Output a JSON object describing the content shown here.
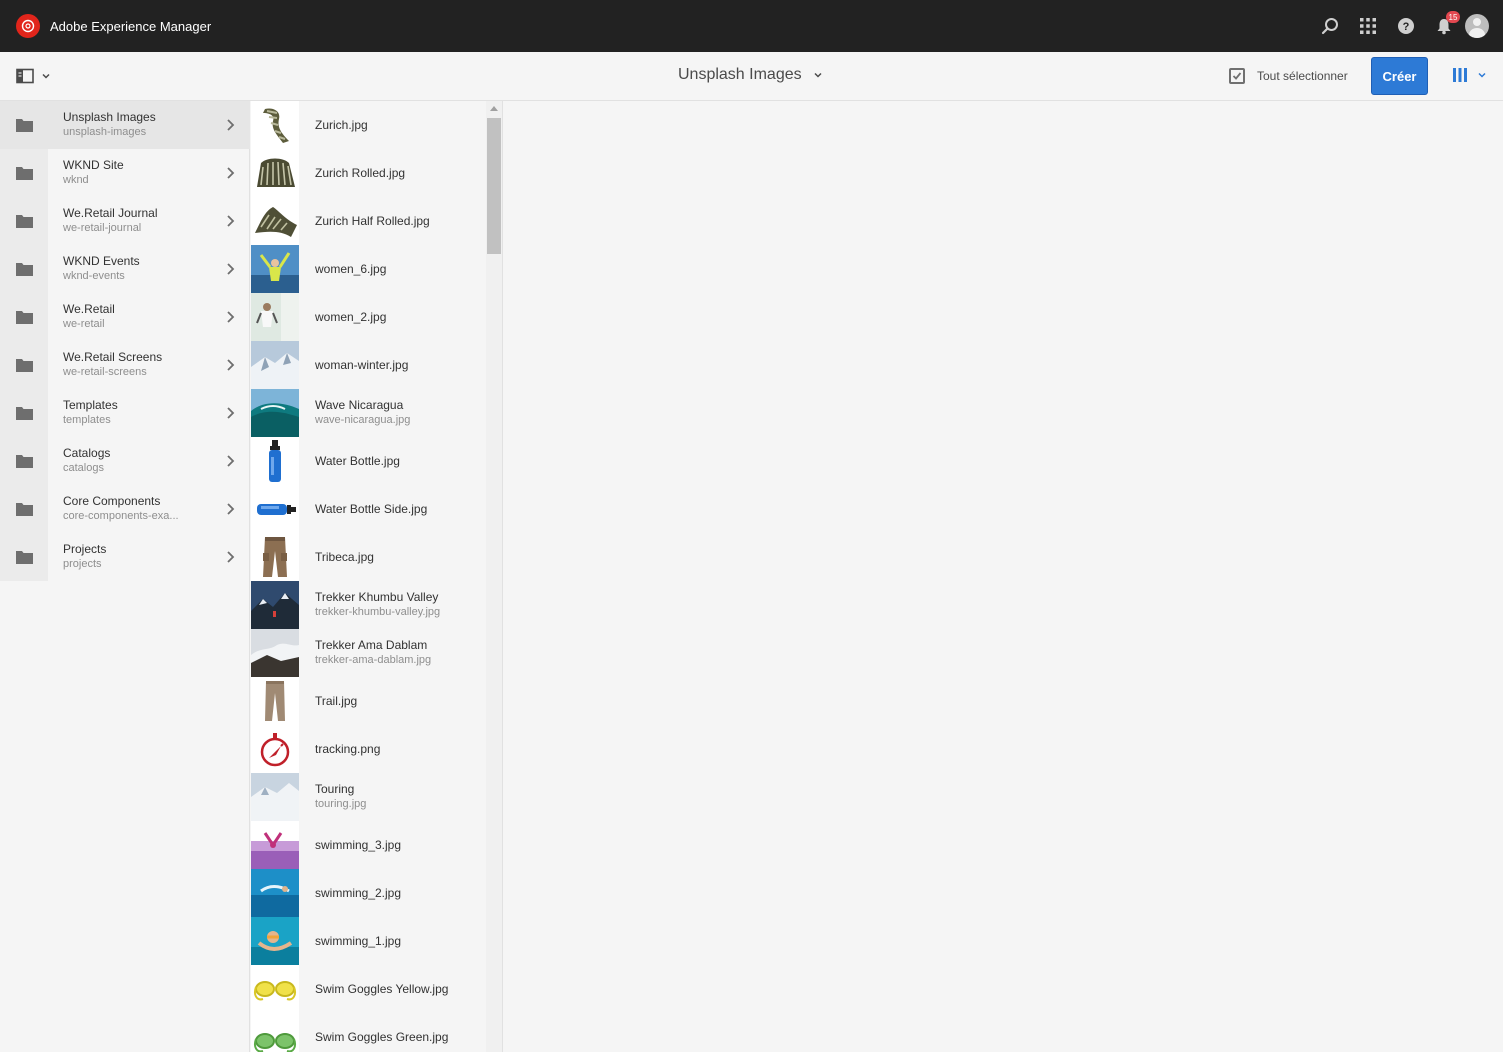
{
  "shell": {
    "app_title": "Adobe Experience Manager",
    "icons": [
      "adobe-logo-icon",
      "search-icon",
      "apps-grid-icon",
      "help-icon",
      "bell-icon",
      "avatar"
    ],
    "notification_count": "15"
  },
  "actionbar": {
    "title": "Unsplash Images",
    "select_all": "Tout sélectionner",
    "create": "Créer",
    "view": "column-view-icon"
  },
  "column1": [
    {
      "title": "Unsplash Images",
      "name": "unsplash-images",
      "selected": true
    },
    {
      "title": "WKND Site",
      "name": "wknd"
    },
    {
      "title": "We.Retail Journal",
      "name": "we-retail-journal"
    },
    {
      "title": "WKND Events",
      "name": "wknd-events"
    },
    {
      "title": "We.Retail",
      "name": "we-retail"
    },
    {
      "title": "We.Retail Screens",
      "name": "we-retail-screens"
    },
    {
      "title": "Templates",
      "name": "templates"
    },
    {
      "title": "Catalogs",
      "name": "catalogs"
    },
    {
      "title": "Core Components",
      "name": "core-components-exa..."
    },
    {
      "title": "Projects",
      "name": "projects"
    }
  ],
  "column2": [
    {
      "title": "Zurich.jpg",
      "name": ""
    },
    {
      "title": "Zurich Rolled.jpg",
      "name": ""
    },
    {
      "title": "Zurich Half Rolled.jpg",
      "name": ""
    },
    {
      "title": "women_6.jpg",
      "name": ""
    },
    {
      "title": "women_2.jpg",
      "name": ""
    },
    {
      "title": "woman-winter.jpg",
      "name": ""
    },
    {
      "title": "Wave Nicaragua",
      "name": "wave-nicaragua.jpg"
    },
    {
      "title": "Water Bottle.jpg",
      "name": ""
    },
    {
      "title": "Water Bottle Side.jpg",
      "name": ""
    },
    {
      "title": "Tribeca.jpg",
      "name": ""
    },
    {
      "title": "Trekker Khumbu Valley",
      "name": "trekker-khumbu-valley.jpg"
    },
    {
      "title": "Trekker Ama Dablam",
      "name": "trekker-ama-dablam.jpg"
    },
    {
      "title": "Trail.jpg",
      "name": ""
    },
    {
      "title": "tracking.png",
      "name": ""
    },
    {
      "title": "Touring",
      "name": "touring.jpg"
    },
    {
      "title": "swimming_3.jpg",
      "name": ""
    },
    {
      "title": "swimming_2.jpg",
      "name": ""
    },
    {
      "title": "swimming_1.jpg",
      "name": ""
    },
    {
      "title": "Swim Goggles Yellow.jpg",
      "name": ""
    },
    {
      "title": "Swim Goggles Green.jpg",
      "name": ""
    }
  ],
  "colors": {
    "shell_bg": "#222222",
    "accent": "#2d7ad6",
    "badge": "#e34850",
    "logo": "#e1251b"
  }
}
